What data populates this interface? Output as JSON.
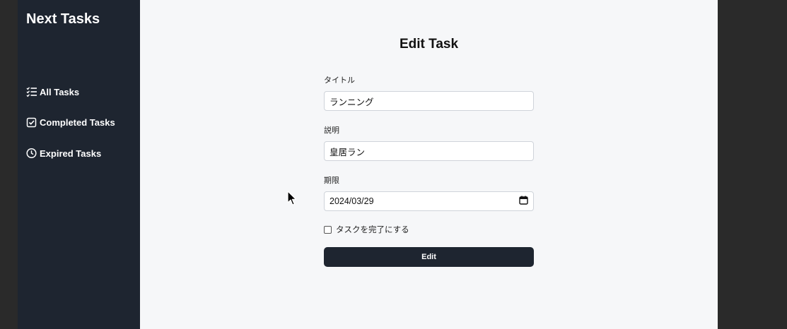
{
  "sidebar": {
    "brand": "Next Tasks",
    "items": [
      {
        "label": "All Tasks",
        "icon": "list-check-icon"
      },
      {
        "label": "Completed Tasks",
        "icon": "checkbox-icon"
      },
      {
        "label": "Expired Tasks",
        "icon": "clock-icon"
      }
    ]
  },
  "main": {
    "title": "Edit Task",
    "form": {
      "title_label": "タイトル",
      "title_value": "ランニング",
      "description_label": "説明",
      "description_value": "皇居ラン",
      "due_label": "期限",
      "due_value": "2024/03/29",
      "complete_label": "タスクを完了にする",
      "submit_label": "Edit"
    }
  },
  "colors": {
    "sidebar_bg": "#1e2530",
    "main_bg": "#f6f7f9",
    "button_bg": "#1e2530"
  }
}
